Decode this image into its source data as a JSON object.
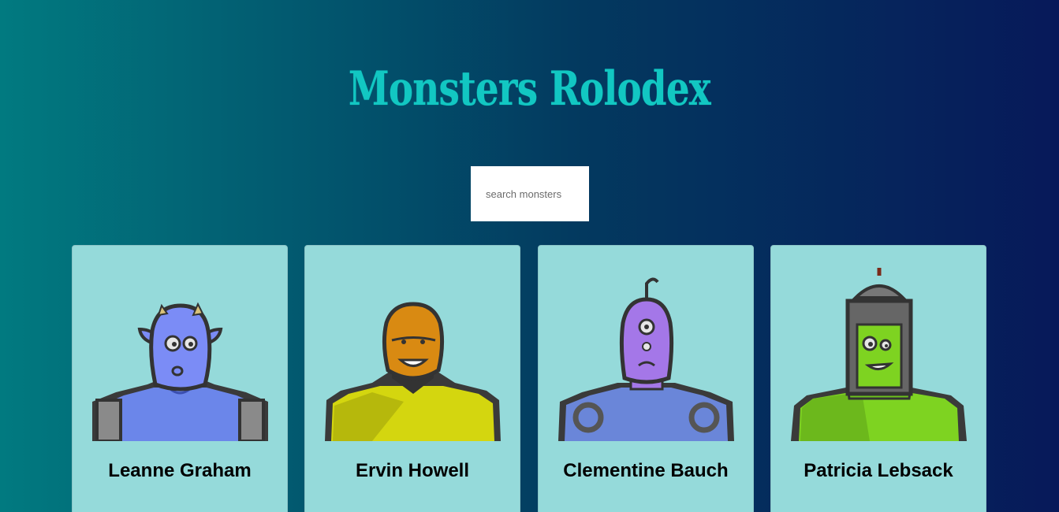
{
  "app": {
    "title": "Monsters Rolodex"
  },
  "search": {
    "placeholder": "search monsters",
    "value": ""
  },
  "monsters": [
    {
      "name": "Leanne Graham",
      "skin": "#7b8cf6",
      "body": "#5f82e8",
      "icon": "monster-avatar-icon"
    },
    {
      "name": "Ervin Howell",
      "skin": "#d98a12",
      "body": "#d4d60f",
      "icon": "monster-avatar-icon"
    },
    {
      "name": "Clementine Bauch",
      "skin": "#a477e8",
      "body": "#6a86d9",
      "icon": "monster-avatar-icon"
    },
    {
      "name": "Patricia Lebsack",
      "skin": "#7ed321",
      "body": "#6cc21c",
      "icon": "monster-avatar-icon"
    }
  ],
  "colors": {
    "title": "#12c7c2",
    "card_background": "#95dada",
    "background_left": "#017a80",
    "background_right": "#07195a"
  }
}
